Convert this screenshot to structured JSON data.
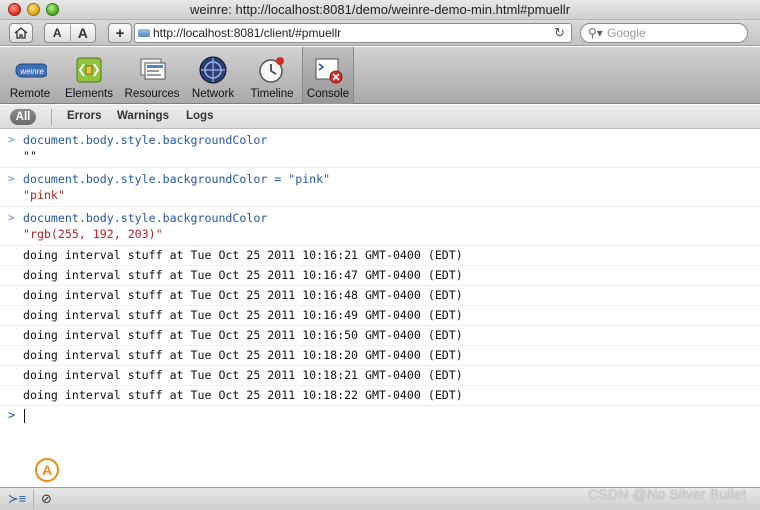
{
  "window": {
    "title": "weinre: http://localhost:8081/demo/weinre-demo-min.html#pmuellr"
  },
  "addressbar": {
    "font_small": "A",
    "font_large": "A",
    "add": "+",
    "url": "http://localhost:8081/client/#pmuellr",
    "reload": "↻",
    "search_placeholder": "Google"
  },
  "toolbar": {
    "items": [
      {
        "label": "Remote",
        "icon": "weinre-logo-icon"
      },
      {
        "label": "Elements",
        "icon": "elements-icon"
      },
      {
        "label": "Resources",
        "icon": "resources-icon"
      },
      {
        "label": "Network",
        "icon": "network-icon"
      },
      {
        "label": "Timeline",
        "icon": "timeline-icon"
      },
      {
        "label": "Console",
        "icon": "console-icon",
        "selected": true
      }
    ],
    "remote_logo_text": "weinre"
  },
  "filters": {
    "all": "All",
    "errors": "Errors",
    "warnings": "Warnings",
    "logs": "Logs",
    "selected": "All"
  },
  "console": {
    "entries": [
      {
        "command": "document.body.style.backgroundColor",
        "result": "\"\""
      },
      {
        "command": "document.body.style.backgroundColor = \"pink\"",
        "result": "\"pink\""
      },
      {
        "command": "document.body.style.backgroundColor",
        "result": "\"rgb(255, 192, 203)\""
      }
    ],
    "logs": [
      "doing interval stuff at Tue Oct 25 2011 10:16:21 GMT-0400 (EDT)",
      "doing interval stuff at Tue Oct 25 2011 10:16:47 GMT-0400 (EDT)",
      "doing interval stuff at Tue Oct 25 2011 10:16:48 GMT-0400 (EDT)",
      "doing interval stuff at Tue Oct 25 2011 10:16:49 GMT-0400 (EDT)",
      "doing interval stuff at Tue Oct 25 2011 10:16:50 GMT-0400 (EDT)",
      "doing interval stuff at Tue Oct 25 2011 10:18:20 GMT-0400 (EDT)",
      "doing interval stuff at Tue Oct 25 2011 10:18:21 GMT-0400 (EDT)",
      "doing interval stuff at Tue Oct 25 2011 10:18:22 GMT-0400 (EDT)"
    ],
    "prompt": ">"
  },
  "overlay_badge": "A",
  "statusbar": {
    "toggle_icon": "console-toggle-icon",
    "clear_icon": "clear-console-icon"
  },
  "watermark": "CSDN @No Silver Bullet",
  "colors": {
    "command": "#2358a8",
    "string_result": "#b42320",
    "badge": "#f08a10"
  }
}
